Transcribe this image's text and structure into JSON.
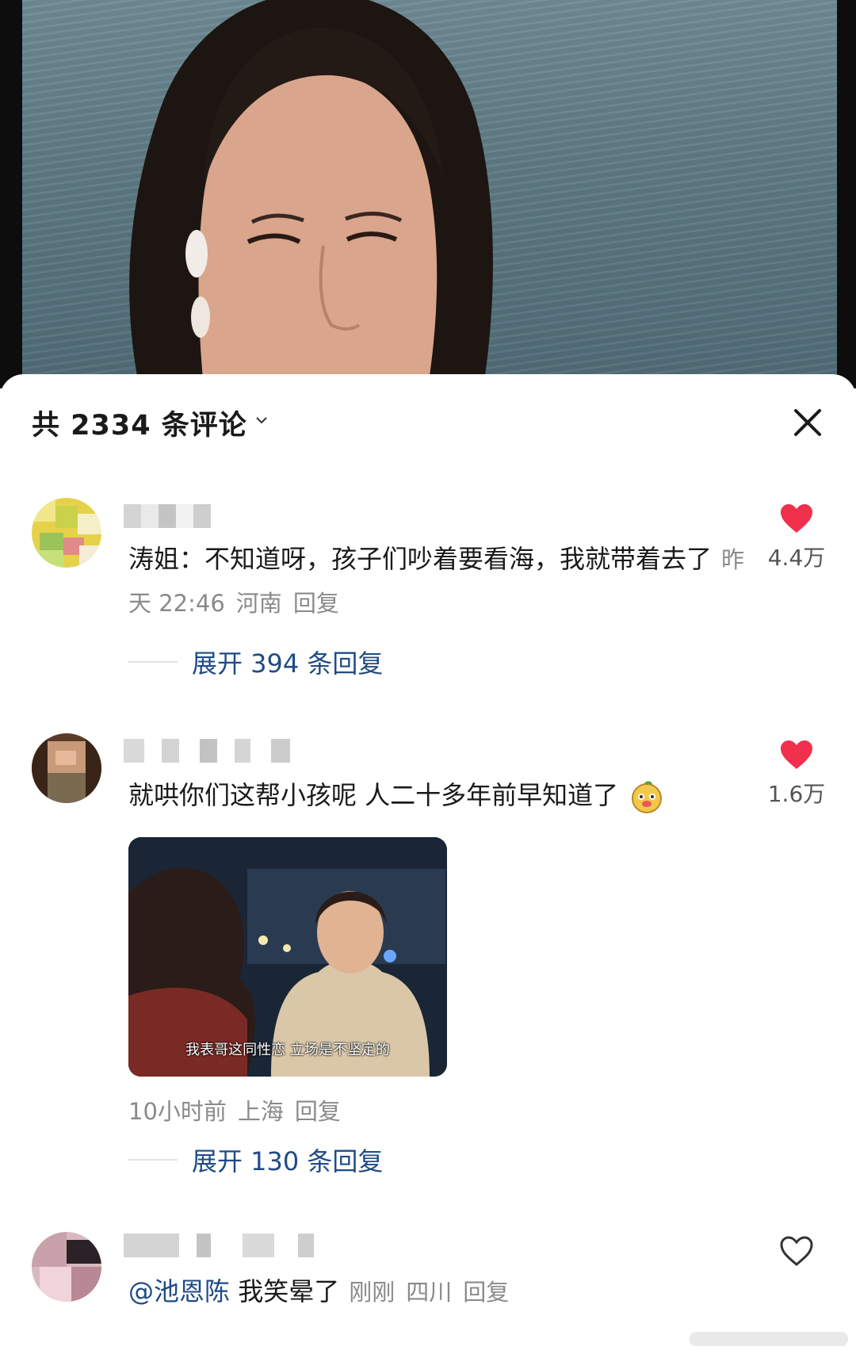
{
  "comments_panel": {
    "title": "共 2334 条评论",
    "comments": [
      {
        "text": "涛姐：不知道呀，孩子们吵着要看海，我就带着去了",
        "time": "昨天 22:46",
        "location": "河南",
        "reply_label": "回复",
        "likes": "4.4万",
        "liked": true,
        "expand_label": "展开 394 条回复"
      },
      {
        "text": "就哄你们这帮小孩呢 人二十多年前早知道了",
        "image_subtitle": "我表哥这同性恋 立场是不坚定的",
        "time": "10小时前",
        "location": "上海",
        "reply_label": "回复",
        "likes": "1.6万",
        "liked": true,
        "expand_label": "展开 130 条回复"
      },
      {
        "mention": "@池恩陈",
        "text": "我笑晕了",
        "time": "刚刚",
        "location": "四川",
        "reply_label": "回复",
        "liked": false
      }
    ]
  },
  "colors": {
    "like_red": "#f0304c",
    "link_blue": "#1f4b86",
    "meta_gray": "#8a8a8a"
  },
  "icons": [
    "chevron-down-icon",
    "close-icon",
    "heart-filled-icon",
    "heart-outline-icon",
    "emoji-icon"
  ]
}
